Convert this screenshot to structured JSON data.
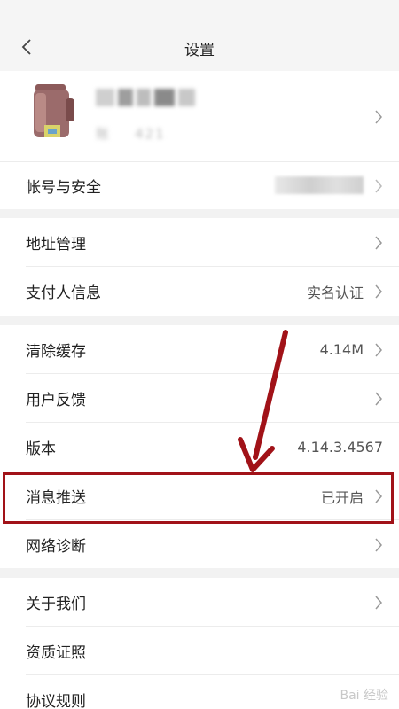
{
  "header": {
    "title": "设置"
  },
  "profile": {
    "id_prefix": "账",
    "id_partial": "421"
  },
  "rows": {
    "account": {
      "label": "帐号与安全"
    },
    "address": {
      "label": "地址管理"
    },
    "payer": {
      "label": "支付人信息",
      "value": "实名认证"
    },
    "cache": {
      "label": "清除缓存",
      "value": "4.14M"
    },
    "feedback": {
      "label": "用户反馈"
    },
    "version": {
      "label": "版本",
      "value": "4.14.3.4567"
    },
    "push": {
      "label": "消息推送",
      "value": "已开启"
    },
    "network": {
      "label": "网络诊断"
    },
    "about": {
      "label": "关于我们"
    },
    "license": {
      "label": "资质证照"
    },
    "agreement": {
      "label": "协议规则"
    }
  },
  "watermark": "Bai 经验",
  "colors": {
    "annotation": "#a11218",
    "page_bg": "#f2f2f2",
    "row_bg": "#ffffff"
  },
  "icons": {
    "back": "chevron-left-icon",
    "row_arrow": "chevron-right-icon"
  }
}
